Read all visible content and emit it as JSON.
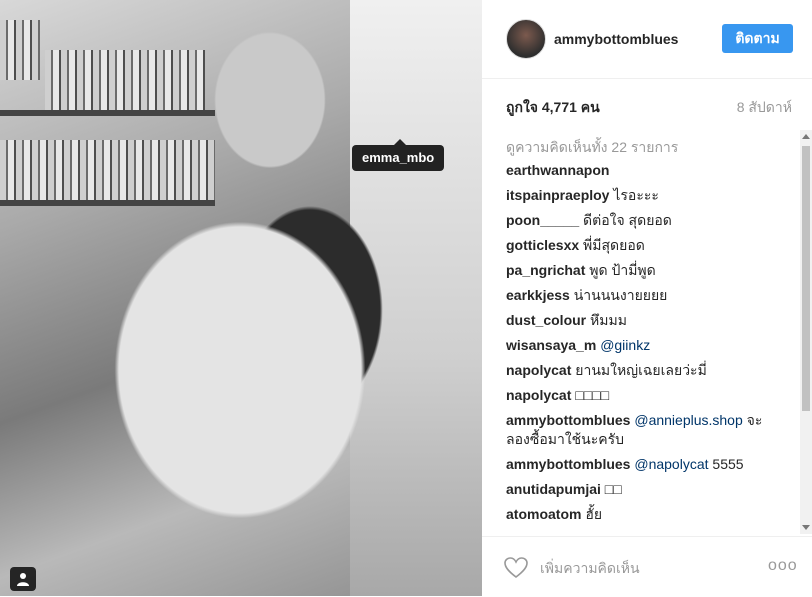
{
  "photo": {
    "tag_label": "emma_mbo"
  },
  "post": {
    "username": "ammybottomblues",
    "follow_label": "ติดตาม",
    "likes": "ถูกใจ 4,771 คน",
    "time": "8 สัปดาห์",
    "view_all": "ดูความคิดเห็นทั้ง 22 รายการ"
  },
  "comments": [
    {
      "user": "earthwannapon",
      "text": "",
      "mention": ""
    },
    {
      "user": "itspainpraeploy",
      "text": "ไรอะะะ",
      "mention": ""
    },
    {
      "user": "poon_____",
      "text": "ดีต่อใจ สุดยอด",
      "mention": ""
    },
    {
      "user": "gotticlesxx",
      "text": "พี่มีสุดยอด",
      "mention": ""
    },
    {
      "user": "pa_ngrichat",
      "text": "พูด ป้ามี่พูด",
      "mention": ""
    },
    {
      "user": "earkkjess",
      "text": "น่านนนงายยยย",
      "mention": ""
    },
    {
      "user": "dust_colour",
      "text": "หึมมม",
      "mention": ""
    },
    {
      "user": "wisansaya_m",
      "text": "",
      "mention": "@giinkz"
    },
    {
      "user": "napolycat",
      "text": "ยานมใหญ่เฉยเลยว่ะมี่",
      "mention": ""
    },
    {
      "user": "napolycat",
      "text": "□□□□",
      "mention": ""
    },
    {
      "user": "ammybottomblues",
      "mention": "@annieplus.shop",
      "text": "จะ ลองซื้อมาใช้นะครับ"
    },
    {
      "user": "ammybottomblues",
      "mention": "@napolycat",
      "text": "5555"
    },
    {
      "user": "anutidapumjai",
      "text": "□□",
      "mention": ""
    },
    {
      "user": "atomoatom",
      "text": "ฮั้ย",
      "mention": ""
    }
  ],
  "footer": {
    "comment_placeholder": "เพิ่มความคิดเห็น",
    "more_label": "ooo"
  },
  "colors": {
    "accent": "#3897f0",
    "mention": "#003569",
    "muted": "#999999"
  }
}
